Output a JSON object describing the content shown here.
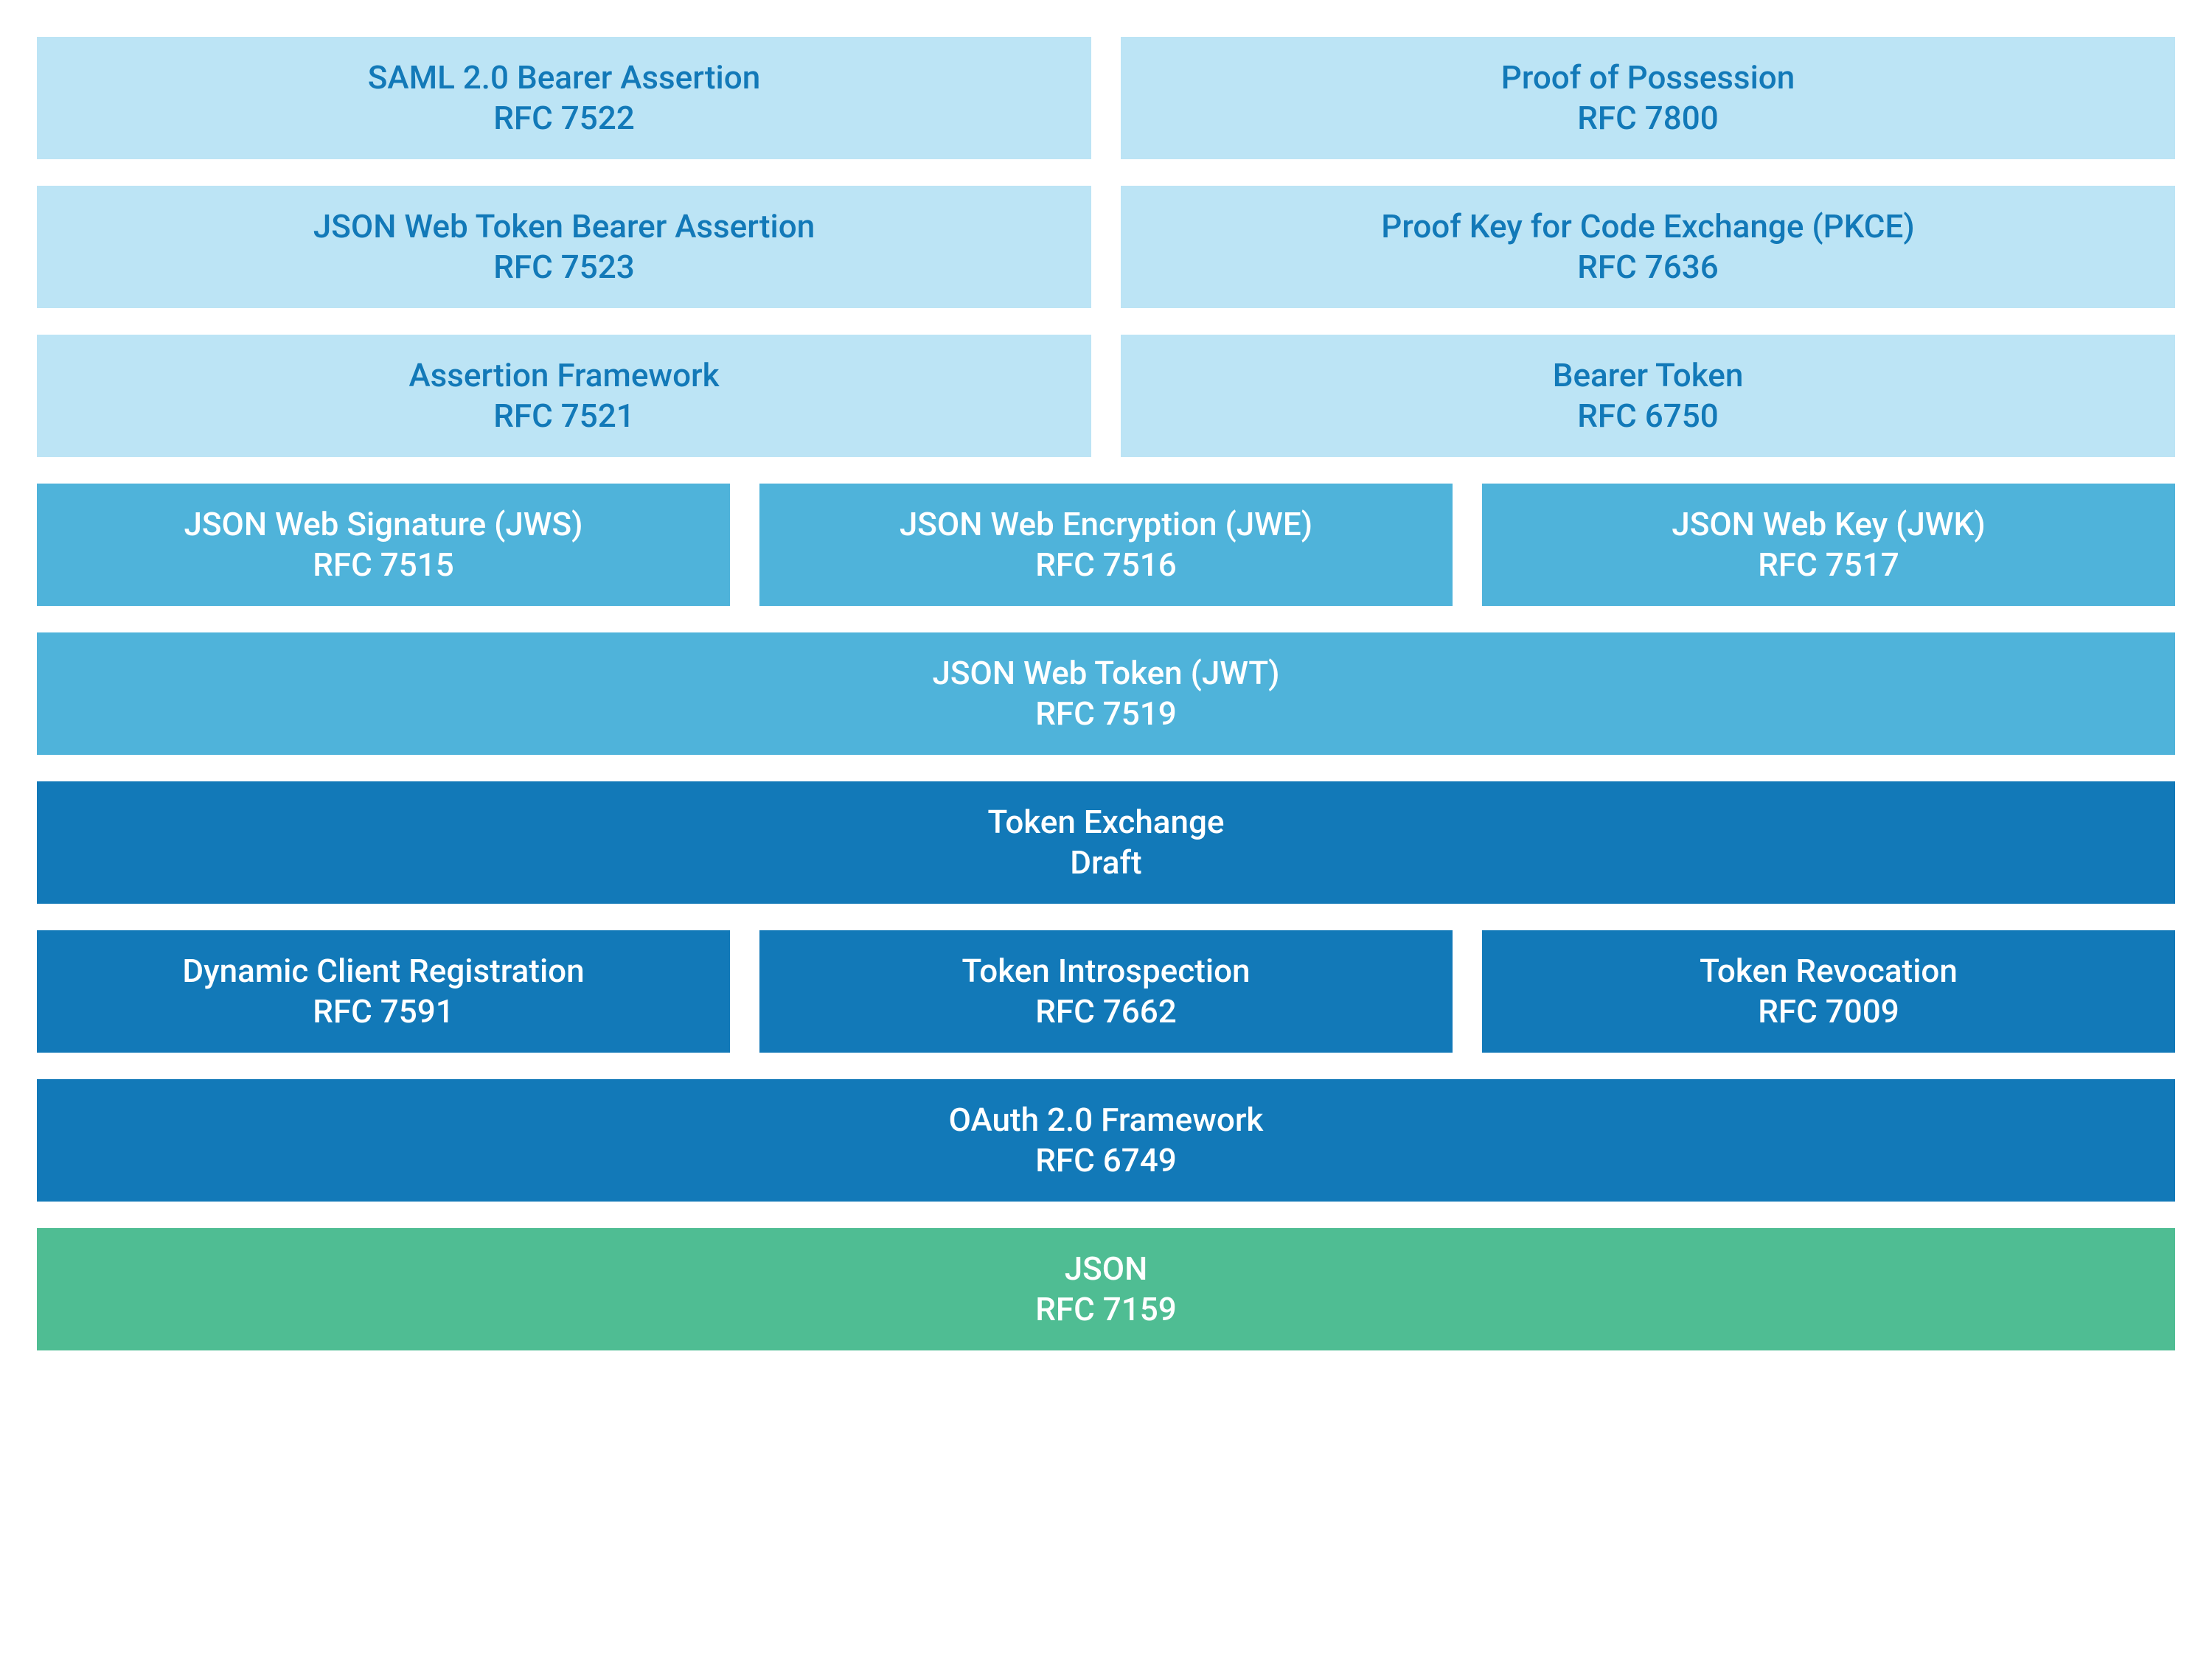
{
  "rows": [
    {
      "tier": "light",
      "boxes": [
        {
          "title": "SAML 2.0 Bearer Assertion",
          "sub": "RFC 7522"
        },
        {
          "title": "Proof of Possession",
          "sub": "RFC 7800"
        }
      ]
    },
    {
      "tier": "light",
      "boxes": [
        {
          "title": "JSON Web Token Bearer Assertion",
          "sub": "RFC 7523"
        },
        {
          "title": "Proof Key for Code Exchange (PKCE)",
          "sub": "RFC 7636"
        }
      ]
    },
    {
      "tier": "light",
      "boxes": [
        {
          "title": "Assertion Framework",
          "sub": "RFC 7521"
        },
        {
          "title": "Bearer Token",
          "sub": "RFC 6750"
        }
      ]
    },
    {
      "tier": "mid",
      "boxes": [
        {
          "title": "JSON Web Signature (JWS)",
          "sub": "RFC 7515"
        },
        {
          "title": "JSON Web Encryption (JWE)",
          "sub": "RFC 7516"
        },
        {
          "title": "JSON Web Key (JWK)",
          "sub": "RFC 7517"
        }
      ]
    },
    {
      "tier": "mid",
      "boxes": [
        {
          "title": "JSON Web Token (JWT)",
          "sub": "RFC 7519"
        }
      ]
    },
    {
      "tier": "dark",
      "boxes": [
        {
          "title": "Token Exchange",
          "sub": "Draft"
        }
      ]
    },
    {
      "tier": "dark",
      "boxes": [
        {
          "title": "Dynamic Client Registration",
          "sub": "RFC 7591"
        },
        {
          "title": "Token Introspection",
          "sub": "RFC 7662"
        },
        {
          "title": "Token Revocation",
          "sub": "RFC 7009"
        }
      ]
    },
    {
      "tier": "dark",
      "boxes": [
        {
          "title": "OAuth 2.0 Framework",
          "sub": "RFC 6749"
        }
      ]
    },
    {
      "tier": "green",
      "boxes": [
        {
          "title": "JSON",
          "sub": "RFC 7159"
        }
      ]
    }
  ]
}
